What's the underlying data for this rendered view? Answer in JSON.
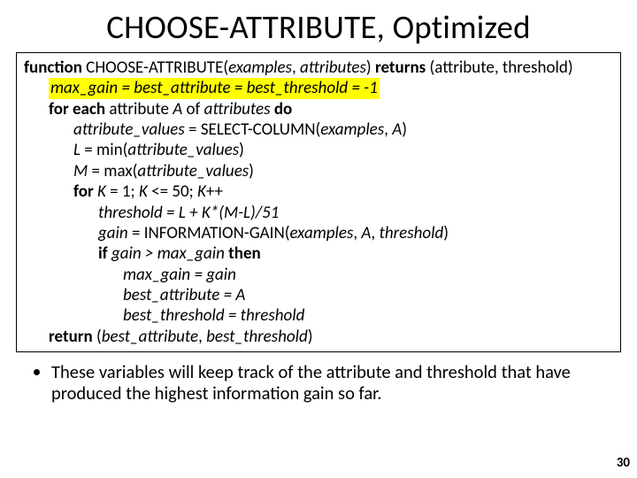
{
  "title": "CHOOSE-ATTRIBUTE, Optimized",
  "sig": {
    "kw_function": "function",
    "fname": " CHOOSE-ATTRIBUTE(",
    "arg1": "examples",
    "comma1": ", ",
    "arg2": "attributes",
    "close": ") ",
    "kw_returns": "returns",
    "ret": " (attribute, threshold)"
  },
  "hl_line": "max_gain = best_attribute = best_threshold = -1",
  "l2": {
    "a": "for each",
    "b": " attribute ",
    "c": "A",
    "d": " of ",
    "e": "attributes ",
    "f": "do"
  },
  "l3": {
    "a": "attribute_values",
    "b": " = SELECT-COLUMN(",
    "c": "examples",
    "d": ", ",
    "e": "A",
    "f": ")"
  },
  "l4": {
    "a": "L ",
    "b": "= min(",
    "c": "attribute_values",
    "d": ")"
  },
  "l5": {
    "a": "M ",
    "b": "= max(",
    "c": "attribute_values",
    "d": ")"
  },
  "l6": {
    "a": "for ",
    "b": "K ",
    "c": "= 1; ",
    "d": "K ",
    "e": "<= 50; ",
    "f": "K",
    "g": "++"
  },
  "l7": {
    "a": "threshold = L + K*(M-L)/51"
  },
  "l8": {
    "a": "gain ",
    "b": "= INFORMATION-GAIN(",
    "c": "examples",
    "d": ", ",
    "e": "A",
    "f": ", ",
    "g": "threshold",
    "h": ")"
  },
  "l9": {
    "a": "if ",
    "b": "gain > max_gain ",
    "c": "then"
  },
  "l10": {
    "a": "max_gain = gain"
  },
  "l11": {
    "a": "best_attribute = A"
  },
  "l12": {
    "a": "best_threshold = threshold"
  },
  "l13": {
    "a": "return ",
    "b": "(",
    "c": "best_attribute",
    "d": ", ",
    "e": "best_threshold",
    "f": ")"
  },
  "bullet": "These variables will keep track of the attribute and threshold that have produced the highest information gain so far.",
  "pagenum": "30"
}
